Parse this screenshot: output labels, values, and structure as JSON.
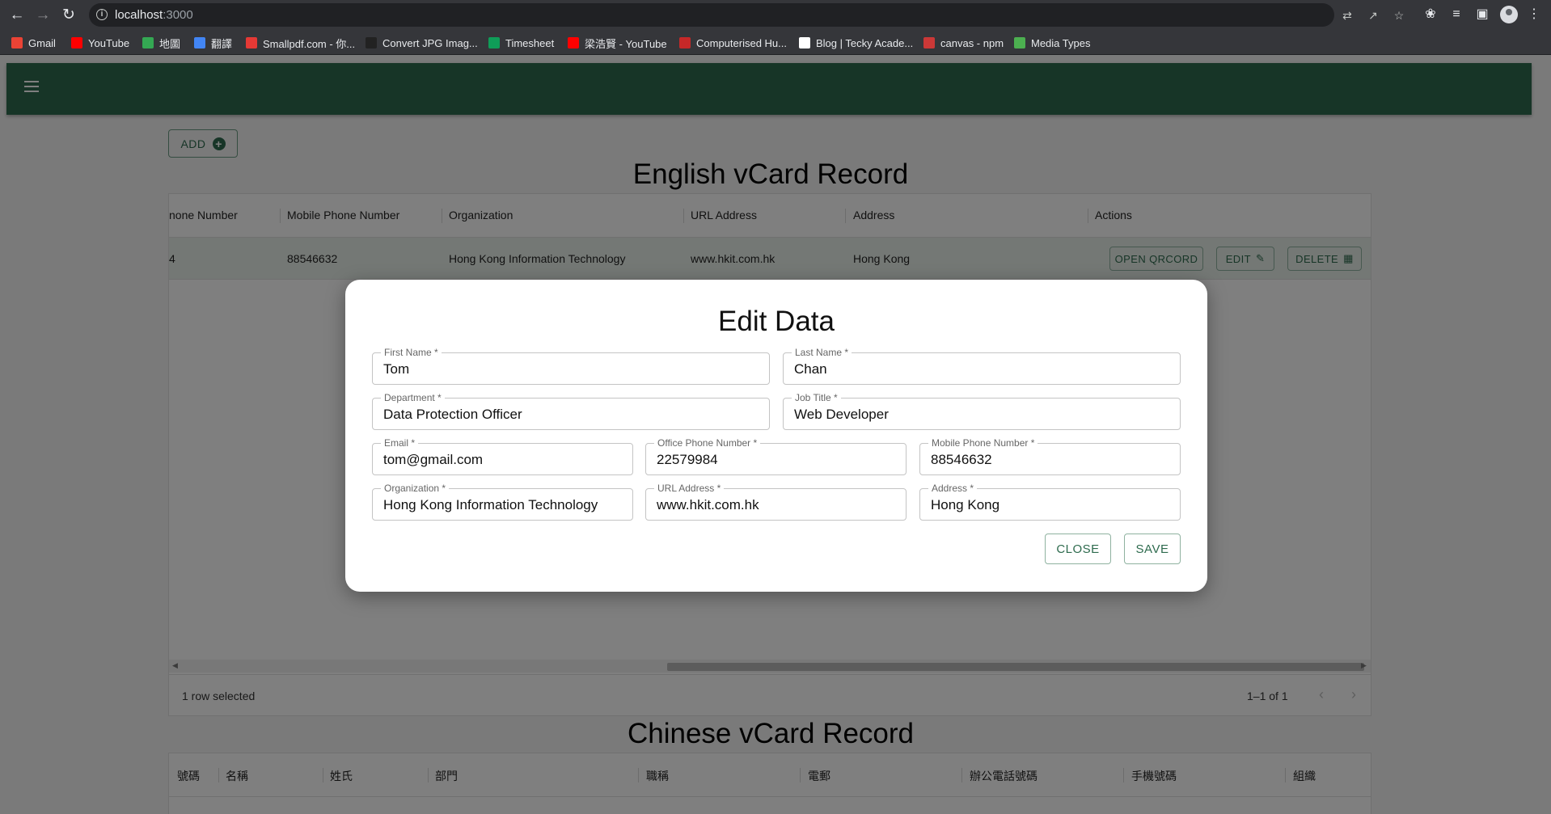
{
  "browser": {
    "url_host": "localhost",
    "url_port": ":3000",
    "bookmarks": [
      {
        "label": "Gmail",
        "color": "#ea4335"
      },
      {
        "label": "YouTube",
        "color": "#ff0000"
      },
      {
        "label": "地圖",
        "color": "#34a853"
      },
      {
        "label": "翻譯",
        "color": "#4285f4"
      },
      {
        "label": "Smallpdf.com - 你...",
        "color": "#e53935"
      },
      {
        "label": "Convert JPG Imag...",
        "color": "#222222"
      },
      {
        "label": "Timesheet",
        "color": "#0f9d58"
      },
      {
        "label": "梁浩賢 - YouTube",
        "color": "#ff0000"
      },
      {
        "label": "Computerised Hu...",
        "color": "#c62828"
      },
      {
        "label": "Blog | Tecky Acade...",
        "color": "#ffffff"
      },
      {
        "label": "canvas - npm",
        "color": "#cb3837"
      },
      {
        "label": "Media Types",
        "color": "#4caf50"
      }
    ]
  },
  "app": {
    "add_label": "ADD",
    "english_title": "English vCard Record",
    "chinese_title": "Chinese vCard Record",
    "english_table": {
      "columns": [
        "none Number",
        "Mobile Phone Number",
        "Organization",
        "URL Address",
        "Address",
        "Actions"
      ],
      "row": {
        "office_phone": "4",
        "mobile": "88546632",
        "organization": "Hong Kong Information Technology",
        "url": "www.hkit.com.hk",
        "address": "Hong Kong"
      },
      "actions": {
        "qr": "OPEN QRCORD",
        "edit": "EDIT",
        "delete": "DELETE"
      },
      "selected_text": "1 row selected",
      "pagination": "1–1 of 1"
    },
    "chinese_table": {
      "columns": [
        "號碼",
        "名稱",
        "姓氏",
        "部門",
        "職稱",
        "電郵",
        "辦公電話號碼",
        "手機號碼",
        "組織"
      ]
    }
  },
  "modal": {
    "title": "Edit Data",
    "fields": {
      "first_name": {
        "label": "First Name *",
        "value": "Tom"
      },
      "last_name": {
        "label": "Last Name *",
        "value": "Chan"
      },
      "department": {
        "label": "Department *",
        "value": "Data Protection Officer"
      },
      "job_title": {
        "label": "Job Title *",
        "value": "Web Developer"
      },
      "email": {
        "label": "Email *",
        "value": "tom@gmail.com"
      },
      "office_phone": {
        "label": "Office Phone Number *",
        "value": "22579984"
      },
      "mobile_phone": {
        "label": "Mobile Phone Number *",
        "value": "88546632"
      },
      "organization": {
        "label": "Organization *",
        "value": "Hong Kong Information Technology"
      },
      "url": {
        "label": "URL Address *",
        "value": "www.hkit.com.hk"
      },
      "address": {
        "label": "Address *",
        "value": "Hong Kong"
      }
    },
    "close_label": "CLOSE",
    "save_label": "SAVE"
  },
  "colors": {
    "primary": "#2e6b4e",
    "row_selected": "#e8f0ea"
  }
}
